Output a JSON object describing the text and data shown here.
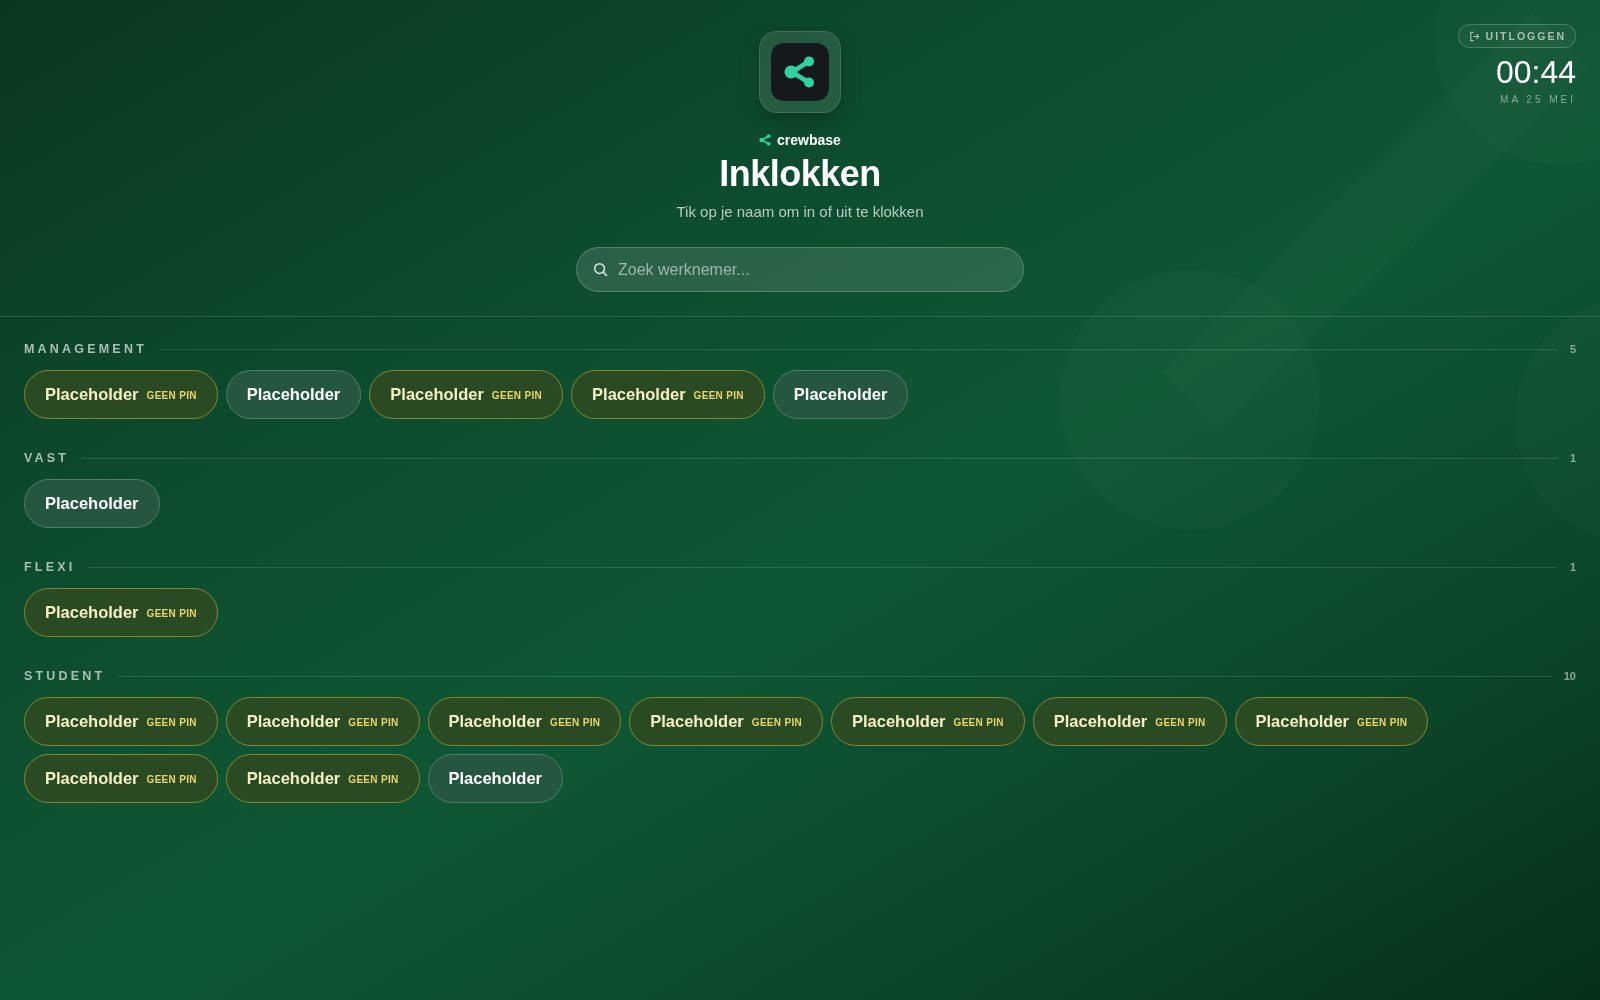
{
  "header": {
    "brand": "crewbase",
    "title": "Inklokken",
    "subtitle": "Tik op je naam om in of uit te klokken",
    "search": {
      "placeholder": "Zoek werknemer..."
    }
  },
  "top_right": {
    "logout_button": "UITLOGGEN",
    "time": "00:44",
    "date": "MA 25 MEI"
  },
  "sections": [
    {
      "title": "MANAGEMENT",
      "count": "5",
      "employees": [
        {
          "name": "Placeholder",
          "has_pin": false,
          "badge": "GEEN PIN"
        },
        {
          "name": "Placeholder",
          "has_pin": true
        },
        {
          "name": "Placeholder",
          "has_pin": false,
          "badge": "GEEN PIN"
        },
        {
          "name": "Placeholder",
          "has_pin": false,
          "badge": "GEEN PIN"
        },
        {
          "name": "Placeholder",
          "has_pin": true
        }
      ]
    },
    {
      "title": "VAST",
      "count": "1",
      "employees": [
        {
          "name": "Placeholder",
          "has_pin": true
        }
      ]
    },
    {
      "title": "FLEXI",
      "count": "1",
      "employees": [
        {
          "name": "Placeholder",
          "has_pin": false,
          "badge": "GEEN PIN"
        }
      ]
    },
    {
      "title": "STUDENT",
      "count": "10",
      "employees": [
        {
          "name": "Placeholder",
          "has_pin": false,
          "badge": "GEEN PIN"
        },
        {
          "name": "Placeholder",
          "has_pin": false,
          "badge": "GEEN PIN"
        },
        {
          "name": "Placeholder",
          "has_pin": false,
          "badge": "GEEN PIN"
        },
        {
          "name": "Placeholder",
          "has_pin": false,
          "badge": "GEEN PIN"
        },
        {
          "name": "Placeholder",
          "has_pin": false,
          "badge": "GEEN PIN"
        },
        {
          "name": "Placeholder",
          "has_pin": false,
          "badge": "GEEN PIN"
        },
        {
          "name": "Placeholder",
          "has_pin": false,
          "badge": "GEEN PIN"
        },
        {
          "name": "Placeholder",
          "has_pin": false,
          "badge": "GEEN PIN"
        },
        {
          "name": "Placeholder",
          "has_pin": false,
          "badge": "GEEN PIN"
        },
        {
          "name": "Placeholder",
          "has_pin": true
        }
      ]
    }
  ]
}
